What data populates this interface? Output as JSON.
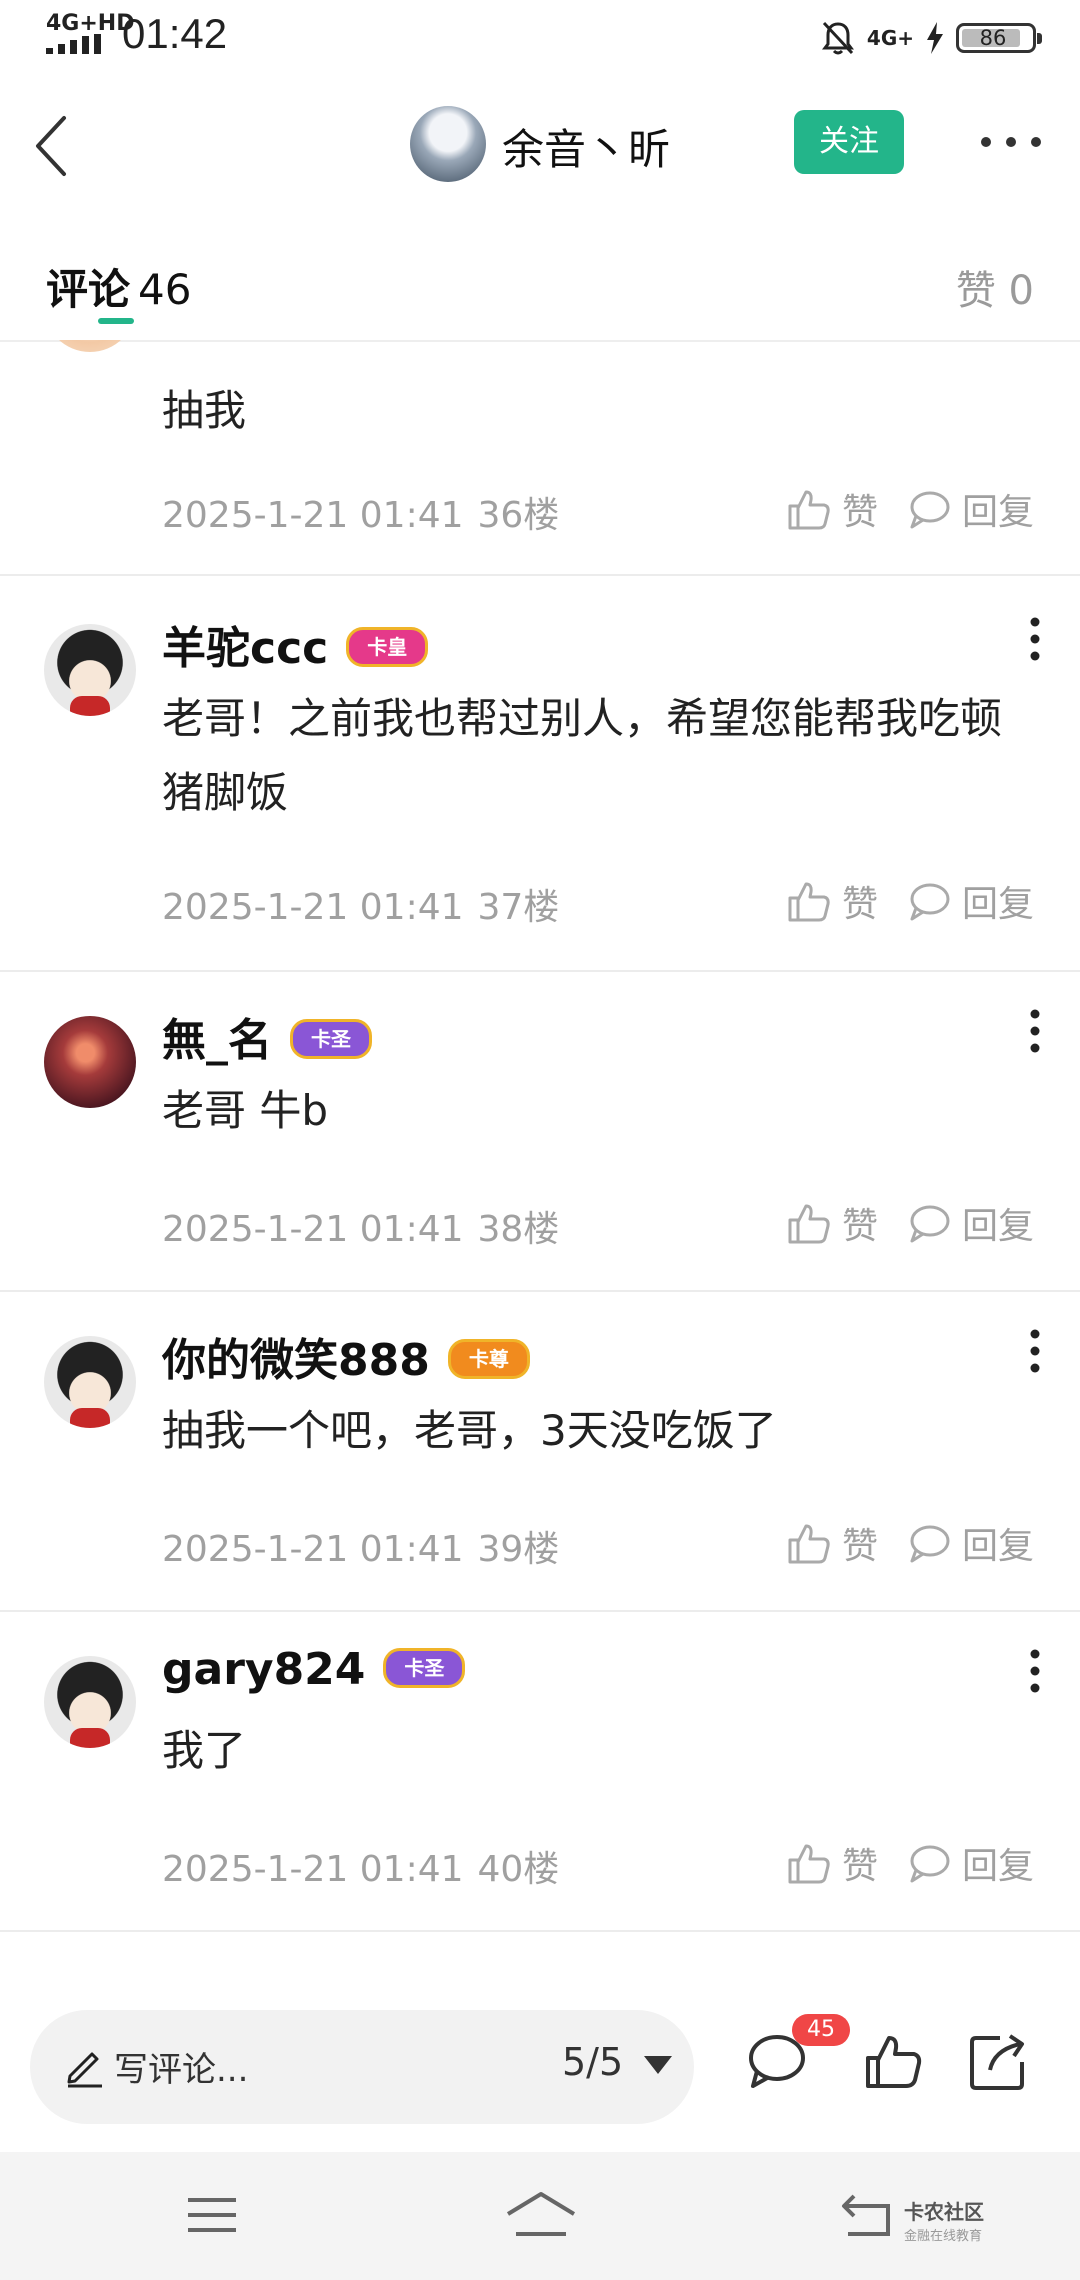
{
  "status_bar": {
    "network_left": "4G+HD",
    "time": "01:42",
    "network_right": "4G+",
    "battery": "86",
    "battery_level_percent": 86
  },
  "header": {
    "username": "余音丶昕",
    "follow_label": "关注"
  },
  "tabs": {
    "comments_label": "评论",
    "comments_count": "46",
    "likes_label": "赞 0"
  },
  "comments": [
    {
      "name": "",
      "badge": "",
      "text": "抽我",
      "date": "2025-1-21 01:41",
      "floor": "36楼"
    },
    {
      "name": "羊驼ccc",
      "badge": "卡皇",
      "text": "老哥！之前我也帮过别人，希望您能帮我吃顿猪脚饭",
      "date": "2025-1-21 01:41",
      "floor": "37楼"
    },
    {
      "name": "無_名",
      "badge": "卡圣",
      "text": "老哥 牛b",
      "date": "2025-1-21 01:41",
      "floor": "38楼"
    },
    {
      "name": "你的微笑888",
      "badge": "卡尊",
      "text": "抽我一个吧，老哥，3天没吃饭了",
      "date": "2025-1-21 01:41",
      "floor": "39楼"
    },
    {
      "name": "gary824",
      "badge": "卡圣",
      "text": "我了",
      "date": "2025-1-21 01:41",
      "floor": "40楼"
    }
  ],
  "actions": {
    "like_label": "赞",
    "reply_label": "回复"
  },
  "bottom_bar": {
    "write_placeholder": "写评论...",
    "page_indicator": "5/5",
    "comment_badge_count": "45"
  },
  "watermark": {
    "title": "卡农社区",
    "subtitle": "金融在线教育"
  },
  "icons": [
    "back-icon",
    "more-icon",
    "like-icon",
    "reply-icon",
    "pen-icon",
    "comment-icon",
    "thumbs-up-icon",
    "share-icon",
    "menu-icon",
    "home-icon",
    "back-nav-icon"
  ],
  "colors": {
    "accent": "#23b58a",
    "badge_red": "#f04646"
  }
}
